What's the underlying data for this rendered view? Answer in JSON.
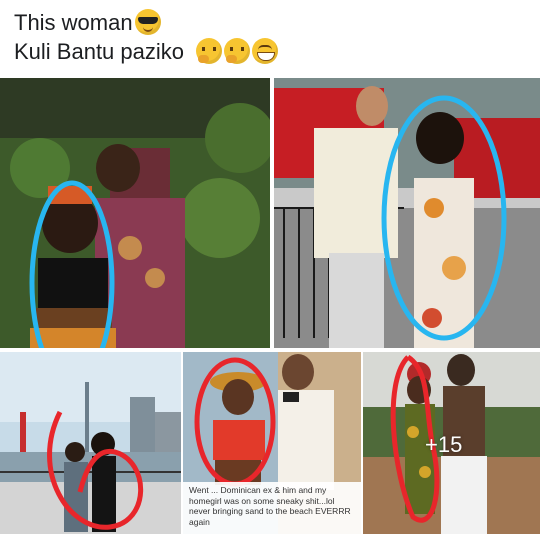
{
  "post": {
    "caption_line1": "This woman",
    "caption_line2": "Kuli Bantu paziko",
    "emoji_line1": [
      "smiling-face-with-sunglasses-icon"
    ],
    "emoji_line2": [
      "thinking-face-icon",
      "thinking-face-icon",
      "grinning-squinting-face-icon"
    ]
  },
  "photos": {
    "bottom_middle_caption": "Went ... Dominican ex & him and my homegirl was on some sneaky shit...lol never bringing sand to the beach EVERRR again",
    "more_count": "+15"
  },
  "colors": {
    "circle_blue": "#28b6f0",
    "circle_red": "#e8262b"
  }
}
